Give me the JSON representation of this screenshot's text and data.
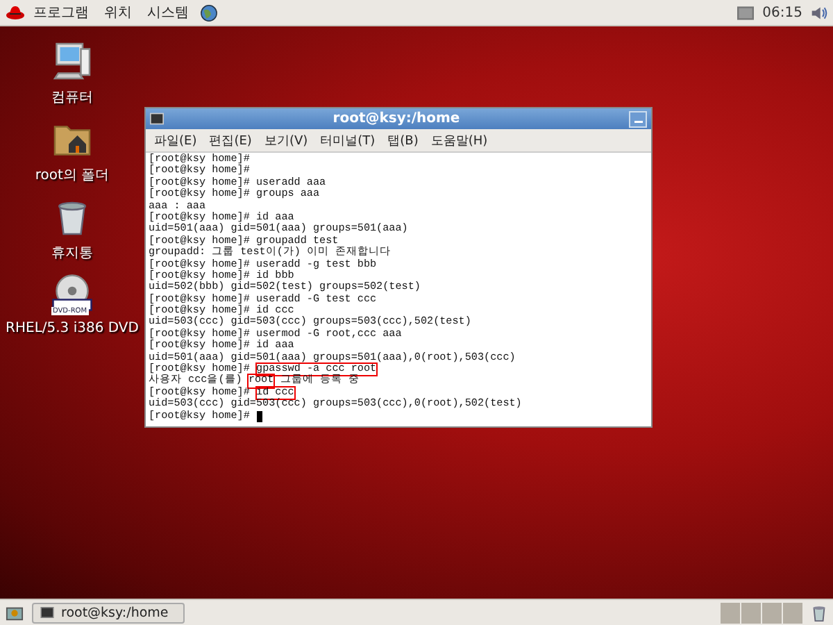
{
  "top_panel": {
    "menus": [
      "프로그램",
      "위치",
      "시스템"
    ],
    "clock": "06:15"
  },
  "desktop_icons": [
    {
      "kind": "computer",
      "label": "컴퓨터"
    },
    {
      "kind": "folder",
      "label": "root의 폴더"
    },
    {
      "kind": "trash",
      "label": "휴지통"
    },
    {
      "kind": "dvd",
      "label": "RHEL/5.3 i386 DVD",
      "badge": "DVD-ROM"
    }
  ],
  "terminal": {
    "title": "root@ksy:/home",
    "menu": [
      "파일(E)",
      "편집(E)",
      "보기(V)",
      "터미널(T)",
      "탭(B)",
      "도움말(H)"
    ],
    "lines": [
      [
        {
          "text": "[root@ksy home]#",
          "boxed": false
        }
      ],
      [
        {
          "text": "[root@ksy home]#",
          "boxed": false
        }
      ],
      [
        {
          "text": "[root@ksy home]# useradd aaa",
          "boxed": false
        }
      ],
      [
        {
          "text": "[root@ksy home]# groups aaa",
          "boxed": false
        }
      ],
      [
        {
          "text": "aaa : aaa",
          "boxed": false
        }
      ],
      [
        {
          "text": "[root@ksy home]# id aaa",
          "boxed": false
        }
      ],
      [
        {
          "text": "uid=501(aaa) gid=501(aaa) groups=501(aaa)",
          "boxed": false
        }
      ],
      [
        {
          "text": "[root@ksy home]# groupadd test",
          "boxed": false
        }
      ],
      [
        {
          "text": "groupadd: 그룹 test이(가) 이미 존재합니다",
          "boxed": false
        }
      ],
      [
        {
          "text": "[root@ksy home]# useradd -g test bbb",
          "boxed": false
        }
      ],
      [
        {
          "text": "[root@ksy home]# id bbb",
          "boxed": false
        }
      ],
      [
        {
          "text": "uid=502(bbb) gid=502(test) groups=502(test)",
          "boxed": false
        }
      ],
      [
        {
          "text": "[root@ksy home]# useradd -G test ccc",
          "boxed": false
        }
      ],
      [
        {
          "text": "[root@ksy home]# id ccc",
          "boxed": false
        }
      ],
      [
        {
          "text": "uid=503(ccc) gid=503(ccc) groups=503(ccc),502(test)",
          "boxed": false
        }
      ],
      [
        {
          "text": "[root@ksy home]# usermod -G root,ccc aaa",
          "boxed": false
        }
      ],
      [
        {
          "text": "[root@ksy home]# id aaa",
          "boxed": false
        }
      ],
      [
        {
          "text": "uid=501(aaa) gid=501(aaa) groups=501(aaa),0(root),503(ccc)",
          "boxed": false
        }
      ],
      [
        {
          "text": "[root@ksy home]#",
          "boxed": false
        },
        {
          "text": "gpasswd -a ccc root",
          "boxed": true
        }
      ],
      [
        {
          "text": "사용자 ccc을(를)",
          "boxed": false
        },
        {
          "text": "root",
          "boxed": true
        },
        {
          "text": "그룹에 등록 중",
          "boxed": false
        }
      ],
      [
        {
          "text": "[root@ksy home]#",
          "boxed": false
        },
        {
          "text": "id ccc",
          "boxed": true
        }
      ],
      [
        {
          "text": "uid=503(ccc) gid=503(ccc) groups=503(ccc),0(root),502(test)",
          "boxed": false
        }
      ],
      [
        {
          "text": "[root@ksy home]#",
          "boxed": false
        }
      ]
    ]
  },
  "taskbar": {
    "tasks": [
      {
        "label": "root@ksy:/home",
        "selected": false
      }
    ]
  }
}
